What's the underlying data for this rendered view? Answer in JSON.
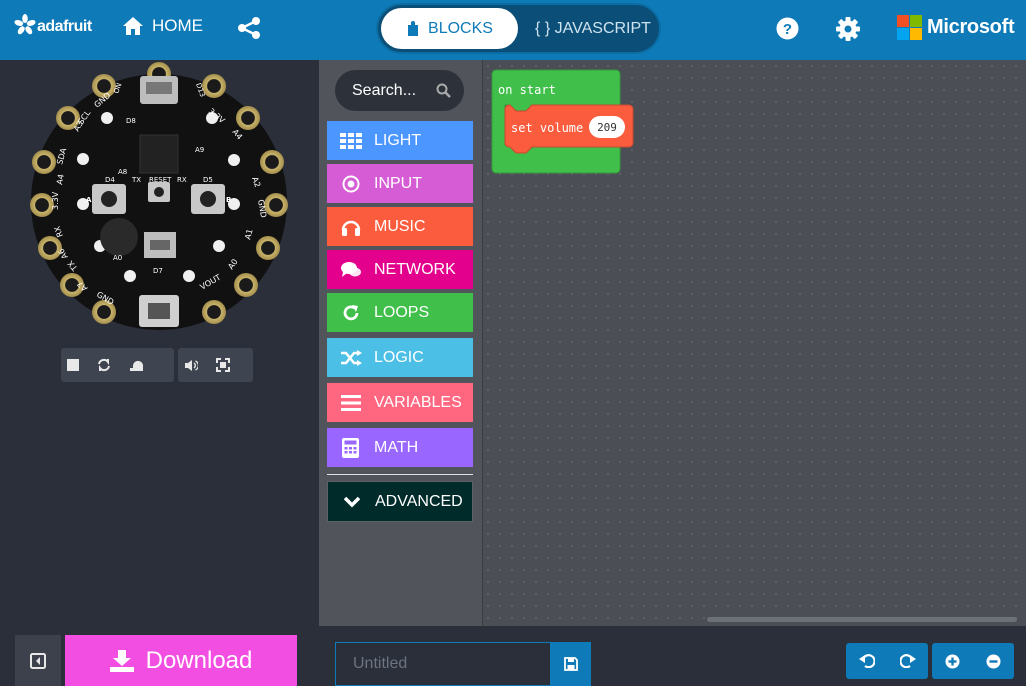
{
  "header": {
    "brand": "adafruit",
    "home_label": "HOME",
    "blocks_label": "BLOCKS",
    "javascript_label": "{ } JAVASCRIPT",
    "microsoft_label": "Microsoft"
  },
  "toolbox": {
    "search_placeholder": "Search...",
    "categories": [
      {
        "label": "LIGHT",
        "color": "#4c97ff",
        "icon": "grid-icon"
      },
      {
        "label": "INPUT",
        "color": "#d65cd6",
        "icon": "target-icon"
      },
      {
        "label": "MUSIC",
        "color": "#fa5c3d",
        "icon": "headphones-icon"
      },
      {
        "label": "NETWORK",
        "color": "#e3008c",
        "icon": "chat-icon"
      },
      {
        "label": "LOOPS",
        "color": "#40bf4a",
        "icon": "refresh-icon"
      },
      {
        "label": "LOGIC",
        "color": "#4cbfe6",
        "icon": "shuffle-icon"
      },
      {
        "label": "VARIABLES",
        "color": "#ff6680",
        "icon": "list-icon"
      },
      {
        "label": "MATH",
        "color": "#9966ff",
        "icon": "calculator-icon"
      },
      {
        "label": "ADVANCED",
        "color": "#002b2b",
        "icon": "chevron-down-icon"
      }
    ]
  },
  "workspace": {
    "on_start_label": "on start",
    "set_volume_label": "set volume",
    "volume_value": "209",
    "on_start_color": "#40bf4a",
    "set_volume_color": "#fa5c3d"
  },
  "board": {
    "pin_labels": [
      "GND",
      "A3",
      "SDA",
      "A4",
      "A5",
      "3.3V",
      "RX",
      "A6",
      "TX",
      "A7",
      "GND",
      "VOUT",
      "A0",
      "A1",
      "A2",
      "GND",
      "3.3V",
      "SCL"
    ],
    "small_labels": {
      "on": "ON",
      "d13": "D13",
      "d8": "D8",
      "a9": "A9",
      "a8": "A8",
      "d4": "D4",
      "tx": "TX",
      "reset": "RESET",
      "rx": "RX",
      "d5": "D5",
      "a0": "A0",
      "d7": "D7",
      "btn_a": "A",
      "btn_b": "B"
    }
  },
  "footer": {
    "download_label": "Download",
    "project_placeholder": "Untitled"
  }
}
